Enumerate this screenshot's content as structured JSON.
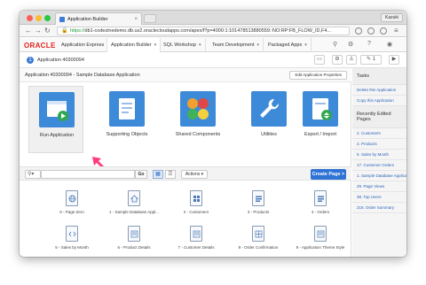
{
  "browser": {
    "tab_title": "Application Builder",
    "tab_close": "×",
    "user": "Kazuki",
    "url_scheme": "https://",
    "url_rest": "db1-codezinedemo.db.us2.oraclecloudapps.com/apex/f?p=4000:1:101478513880559::NO:RP:FB_FLOW_ID,F4..."
  },
  "header": {
    "brand": "ORACLE",
    "product": "Application Express",
    "nav": [
      {
        "label": "Application Builder"
      },
      {
        "label": "SQL Workshop"
      },
      {
        "label": "Team Development"
      },
      {
        "label": "Packaged Apps"
      }
    ]
  },
  "breadcrumb": {
    "badge": "1",
    "text": "Application 40300094"
  },
  "toolbar_right": {
    "count": "1"
  },
  "main": {
    "title": "Application 40300094 - Sample Database Application",
    "edit_properties": "Edit Application Properties",
    "tiles": [
      {
        "label": "Run Application",
        "color": "#3c8ad8"
      },
      {
        "label": "Supporting Objects",
        "color": "#3c8ad8"
      },
      {
        "label": "Shared Components",
        "color": "#3c8ad8"
      },
      {
        "label": "Utilities",
        "color": "#3c8ad8"
      },
      {
        "label": "Export / Import",
        "color": "#3c8ad8"
      }
    ],
    "search": {
      "go": "Go",
      "actions": "Actions",
      "create_page": "Create Page >"
    },
    "pages": [
      {
        "label": "0 - Page Zero",
        "icon": "globe-icon"
      },
      {
        "label": "1 - Sample Database Appl...",
        "icon": "home-icon"
      },
      {
        "label": "2 - Customers",
        "icon": "grid-icon"
      },
      {
        "label": "3 - Products",
        "icon": "form-icon"
      },
      {
        "label": "4 - Orders",
        "icon": "form-icon"
      },
      {
        "label": "5 - Sales by Month",
        "icon": "code-icon"
      },
      {
        "label": "6 - Product Details",
        "icon": "list-icon"
      },
      {
        "label": "7 - Customer Details",
        "icon": "list-icon"
      },
      {
        "label": "8 - Order Confirmation",
        "icon": "table-icon"
      },
      {
        "label": "9 - Application Theme Style",
        "icon": "list-icon"
      }
    ]
  },
  "sidebar": {
    "tasks_title": "Tasks",
    "tasks": [
      "Delete this Application",
      "Copy this Application"
    ],
    "recent_title": "Recently Edited Pages",
    "recent": [
      "2. Customers",
      "3. Products",
      "5. Sales by Month",
      "17. Customer Orders",
      "1. Sample Database Application",
      "29. Page Views",
      "38. Top Users",
      "218. Order Summary"
    ]
  }
}
